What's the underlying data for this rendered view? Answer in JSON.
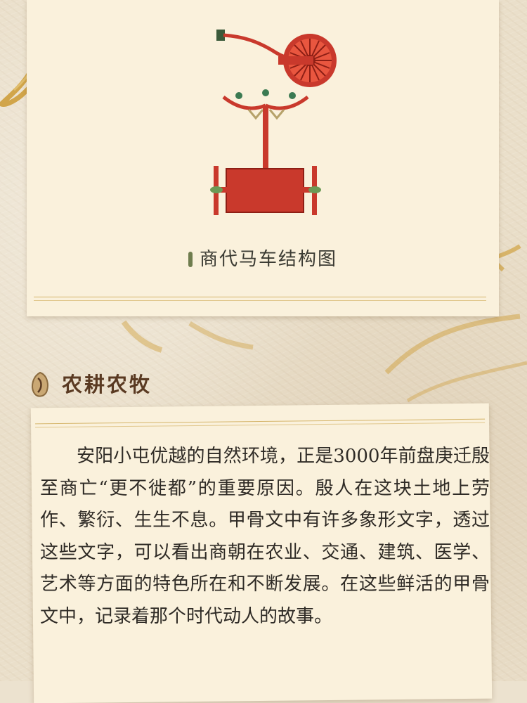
{
  "figure": {
    "caption": "商代马车结构图"
  },
  "section": {
    "title": "农耕农牧"
  },
  "paragraph": "安阳小屯优越的自然环境，正是3000年前盘庚迁殷至商亡“更不徙都”的重要原因。殷人在这块土地上劳作、繁衍、生生不息。甲骨文中有许多象形文字，透过这些文字，可以看出商朝在农业、交通、建筑、医学、艺术等方面的特色所在和不断发展。在这些鲜活的甲骨文中，记录着那个时代动人的故事。",
  "colors": {
    "chariot_red": "#c9392c",
    "accent_green": "#6f7d4e",
    "title_brown": "#5a3a22",
    "gold": "#d1a54a"
  }
}
